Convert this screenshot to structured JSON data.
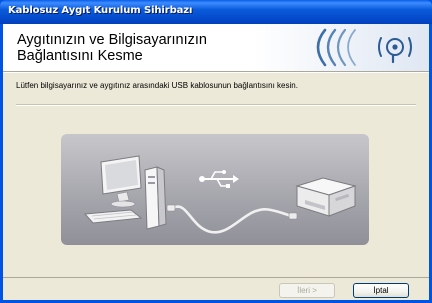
{
  "window": {
    "title": "Kablosuz Aygıt Kurulum Sihirbazı"
  },
  "header": {
    "heading_line1": "Aygıtınızın ve Bilgisayarınızın",
    "heading_line2": "Bağlantısını Kesme",
    "logo_icon": "wireless-signal-icon"
  },
  "body": {
    "instruction": "Lütfen bilgisayarınız ve aygıtınız arasındaki USB kablosunun bağlantısını kesin.",
    "illustration": {
      "computer_icon": "desktop-computer-icon",
      "usb_icon": "usb-symbol-icon",
      "printer_icon": "printer-icon"
    }
  },
  "buttons": {
    "back_label": "İleri >",
    "cancel_label": "İptal"
  },
  "colors": {
    "titlebar": "#0054e3",
    "client_bg": "#ece9d8",
    "header_bg": "#ffffff"
  }
}
